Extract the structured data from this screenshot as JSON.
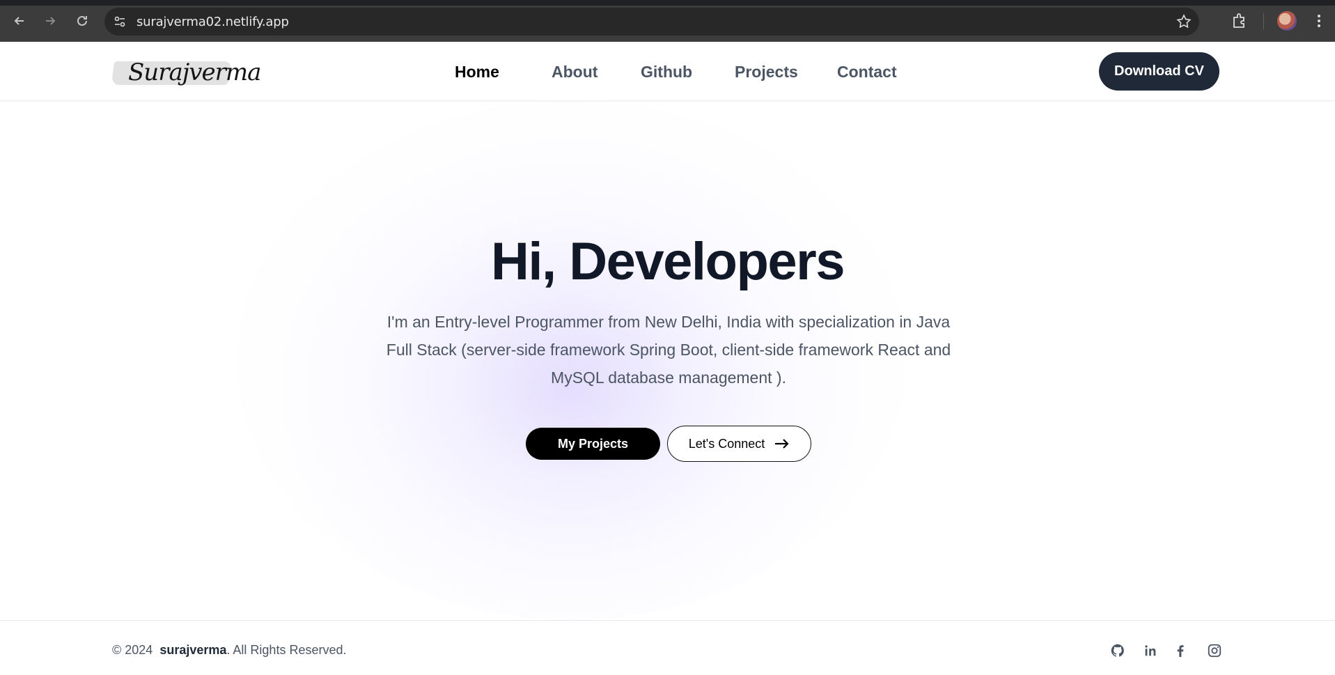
{
  "browser": {
    "url": "surajverma02.netlify.app"
  },
  "header": {
    "logo_text": "Surajverma",
    "nav": [
      {
        "label": "Home",
        "active": true
      },
      {
        "label": "About"
      },
      {
        "label": "Github"
      },
      {
        "label": "Projects"
      },
      {
        "label": "Contact"
      }
    ],
    "cta_label": "Download CV"
  },
  "hero": {
    "title": "Hi, Developers",
    "description": "I'm an Entry-level Programmer from New Delhi, India with specialization in Java Full Stack (server-side framework Spring Boot, client-side framework React and MySQL database management ).",
    "primary_button": "My Projects",
    "secondary_button": "Let's Connect"
  },
  "footer": {
    "copyright_prefix": "© 2024",
    "brand": "surajverma",
    "copyright_suffix": ". All Rights Reserved.",
    "social_icons": [
      "github-icon",
      "linkedin-icon",
      "facebook-icon",
      "instagram-icon"
    ]
  },
  "colors": {
    "primary_dark": "#1f2937",
    "glow": "#c4b5fd"
  }
}
